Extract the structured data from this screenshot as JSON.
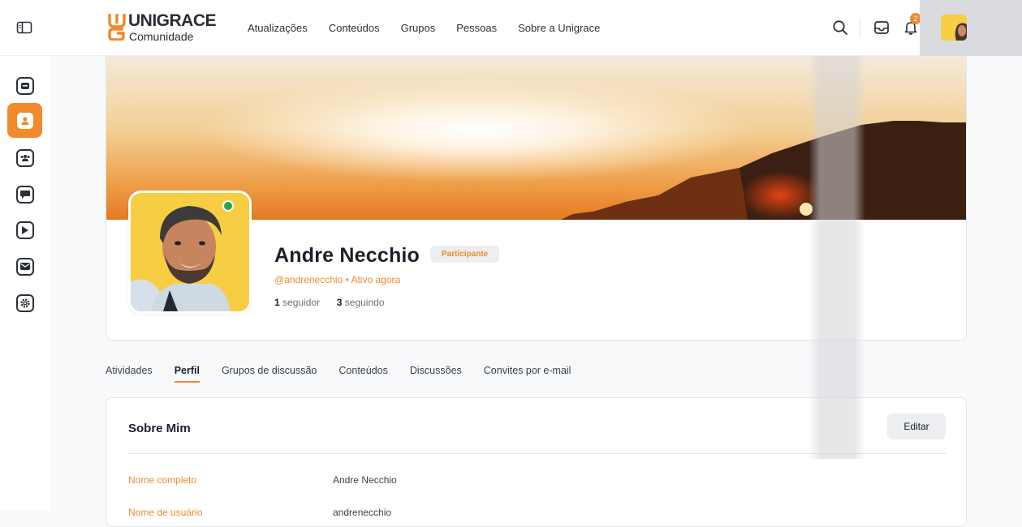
{
  "brand": {
    "title": "UNIGRACE",
    "subtitle": "Comunidade"
  },
  "nav": [
    "Atualizações",
    "Conteúdos",
    "Grupos",
    "Pessoas",
    "Sobre a Unigrace"
  ],
  "header": {
    "notification_count": "2"
  },
  "rail": [
    "dashboard-icon",
    "profile-icon",
    "groups-icon",
    "chat-icon",
    "video-icon",
    "mail-icon",
    "settings-icon"
  ],
  "profile": {
    "name": "Andre Necchio",
    "role": "Participante",
    "handle": "@andrenecchio",
    "status": "Ativo agora",
    "followers_count": "1",
    "followers_label": "seguidor",
    "following_count": "3",
    "following_label": "seguindo"
  },
  "tabs": [
    "Atividades",
    "Perfil",
    "Grupos de discussão",
    "Conteúdos",
    "Discussões",
    "Convites por e-mail"
  ],
  "about": {
    "title": "Sobre Mim",
    "edit_label": "Editar",
    "fields": [
      {
        "label": "Nome completo",
        "value": "Andre Necchio"
      },
      {
        "label": "Nome de usuário",
        "value": "andrenecchio"
      }
    ]
  },
  "colors": {
    "accent": "#f08a2c",
    "online": "#1eaa4f"
  }
}
